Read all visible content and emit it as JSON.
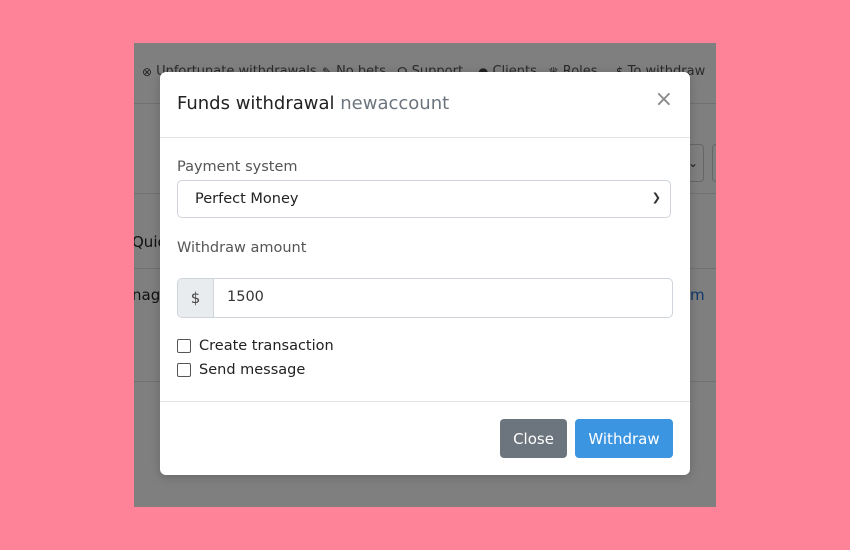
{
  "background_app": {
    "nav_items": [
      {
        "icon": "clock-icon",
        "glyph": "⊗",
        "label": "Unfortunate withdrawals"
      },
      {
        "icon": "pencil-icon",
        "glyph": "✎",
        "label": "No bets"
      },
      {
        "icon": "headset-icon",
        "glyph": "☊",
        "label": "Support"
      },
      {
        "icon": "person-icon",
        "glyph": "●",
        "label": "Clients"
      },
      {
        "icon": "crown-icon",
        "glyph": "♛",
        "label": "Roles"
      },
      {
        "icon": "dollar-icon",
        "glyph": "$",
        "label": "To withdraw"
      }
    ],
    "row_text_1": "Quic",
    "row_text_2": "nage",
    "row_link": "m"
  },
  "modal": {
    "title": "Funds withdrawal",
    "account": "newaccount",
    "close_glyph": "×",
    "payment_label": "Payment system",
    "payment_value": "Perfect Money",
    "amount_label": "Withdraw amount",
    "currency_symbol": "$",
    "amount_value": "1500",
    "checkbox_transaction": "Create transaction",
    "checkbox_message": "Send message",
    "close_button": "Close",
    "withdraw_button": "Withdraw"
  },
  "colors": {
    "page_background": "#fe8298",
    "primary_button": "#3b95e0",
    "secondary_button": "#6c757d"
  }
}
